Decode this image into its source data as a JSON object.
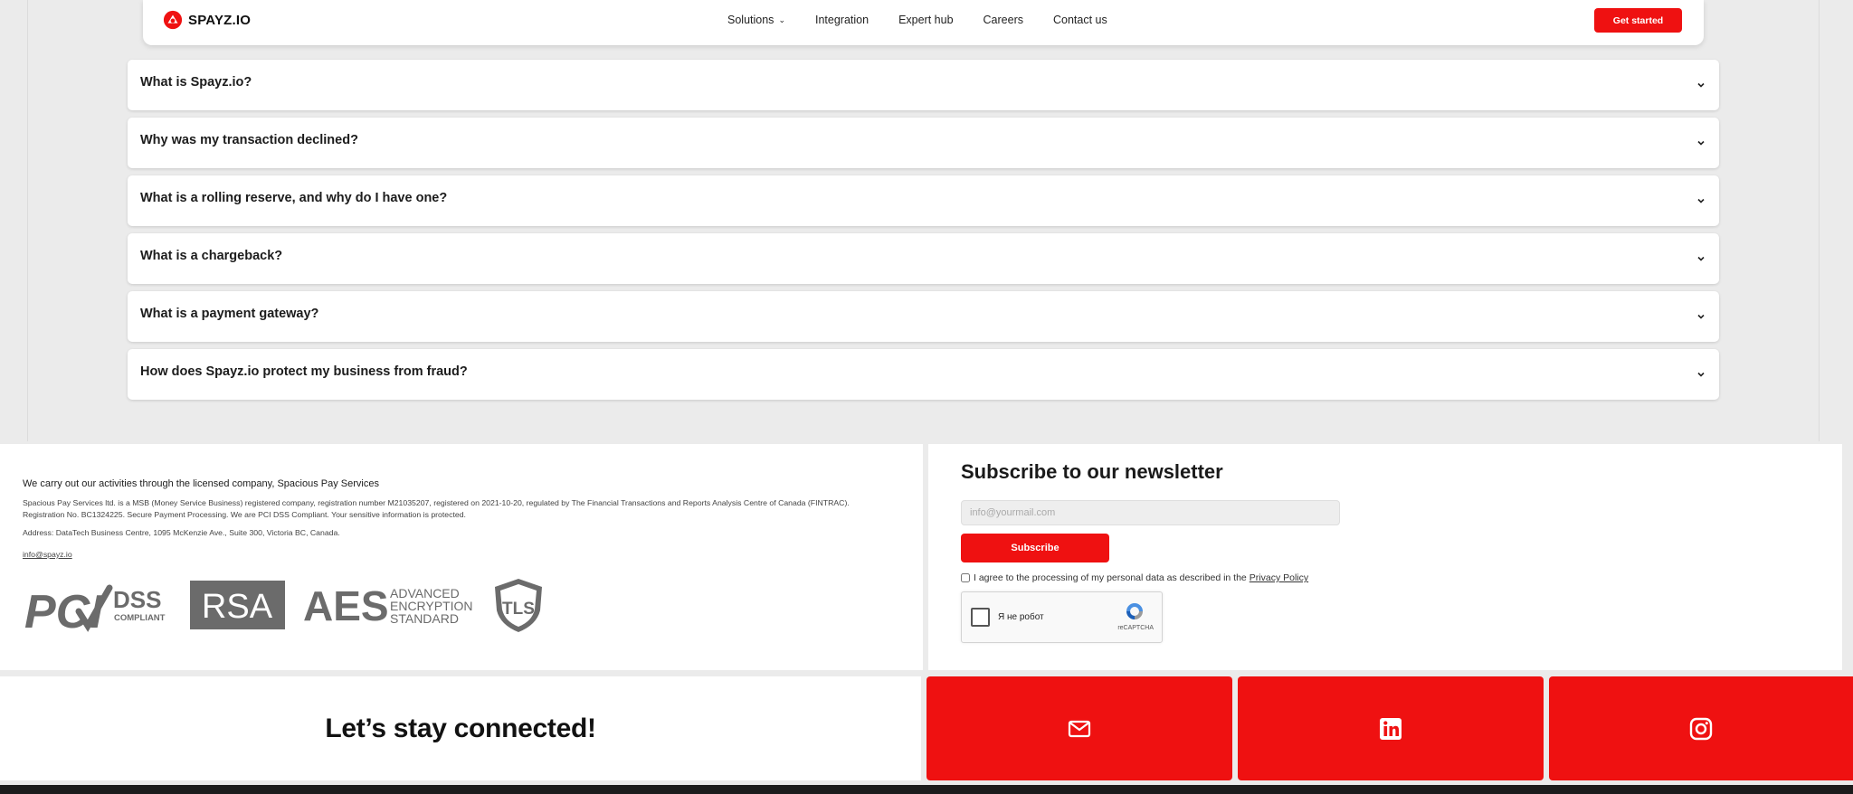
{
  "nav": {
    "brand": "SPAYZ.IO",
    "links": [
      {
        "label": "Solutions",
        "has_dropdown": true
      },
      {
        "label": "Integration"
      },
      {
        "label": "Expert hub"
      },
      {
        "label": "Careers"
      },
      {
        "label": "Contact us"
      }
    ],
    "cta_label": "Get started"
  },
  "faq": {
    "items": [
      {
        "question": "What is Spayz.io?"
      },
      {
        "question": "Why was my transaction declined?"
      },
      {
        "question": "What is a rolling reserve, and why do I have one?"
      },
      {
        "question": "What is a chargeback?"
      },
      {
        "question": "What is a payment gateway?"
      },
      {
        "question": "How does Spayz.io protect my business from fraud?"
      }
    ]
  },
  "legal": {
    "lead": "We carry out our activities through the licensed company, Spacious Pay Services",
    "details": "Spacious Pay Services ltd. is a MSB (Money Service Business) registered company, registration number M21035207, registered on 2021-10-20, regulated by The Financial Transactions and Reports Analysis Centre of Canada (FINTRAC). Registration No. BC1324225. Secure Payment Processing. We are PCI DSS Compliant. Your sensitive information is protected.",
    "address": "Address: DataTech Business Centre, 1095 McKenzie Ave., Suite 300, Victoria BC, Canada.",
    "email": "info@spayz.io",
    "badges": {
      "pci": {
        "name": "PCI",
        "dss": "DSS",
        "compliant": "COMPLIANT"
      },
      "rsa": "RSA",
      "aes": {
        "name": "AES",
        "line1": "ADVANCED",
        "line2": "ENCRYPTION",
        "line3": "STANDARD"
      },
      "tls": "TLS"
    }
  },
  "newsletter": {
    "title": "Subscribe to our newsletter",
    "email_placeholder": "info@yourmail.com",
    "subscribe_label": "Subscribe",
    "consent_text": "I agree to the processing of my personal data as described in the",
    "privacy_link": "Privacy Policy",
    "captcha_label": "Я не робот",
    "captcha_brand": "reCAPTCHA"
  },
  "connect": {
    "title": "Let’s stay connected!",
    "socials": [
      {
        "icon": "mail-icon"
      },
      {
        "icon": "linkedin-icon"
      },
      {
        "icon": "instagram-icon"
      }
    ]
  },
  "colors": {
    "accent": "#ef1111",
    "page_bg": "#ebebeb",
    "footer_dark": "#1c1c1c"
  }
}
